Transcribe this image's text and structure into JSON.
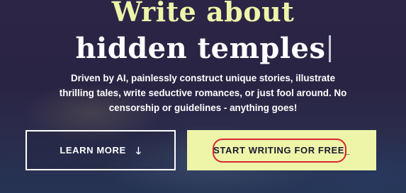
{
  "hero": {
    "headline_line1": "Write about",
    "headline_line2": "hidden temples",
    "description": "Driven by AI, painlessly construct unique stories, illustrate thrilling tales, write seductive romances, or just fool around. No censorship or guidelines - anything goes!"
  },
  "buttons": {
    "learn_more_label": "LEARN MORE",
    "learn_more_icon": "arrow-down-icon",
    "start_writing_label": "START WRITING FOR FREE_"
  },
  "colors": {
    "accent": "#eef5a9",
    "background": "#2a2444",
    "highlight_ring": "#d9252f"
  }
}
